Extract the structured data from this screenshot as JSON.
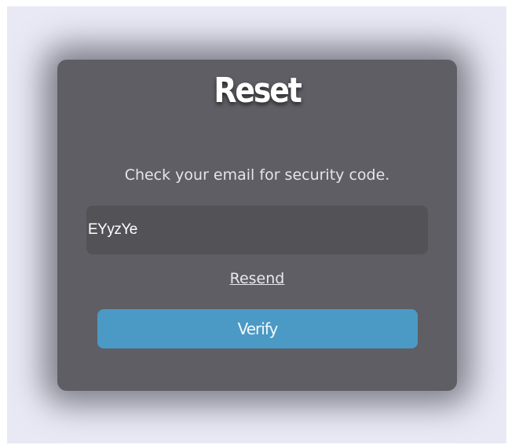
{
  "card": {
    "title": "Reset",
    "message": "Check your email for security code.",
    "code_input": {
      "value": "EYyzYe"
    },
    "resend_label": "Resend",
    "verify_label": "Verify"
  },
  "colors": {
    "page_background": "#e9e9f6",
    "card_background": "#5f5e64",
    "input_background": "#535257",
    "button_background": "#4b9ac5"
  }
}
